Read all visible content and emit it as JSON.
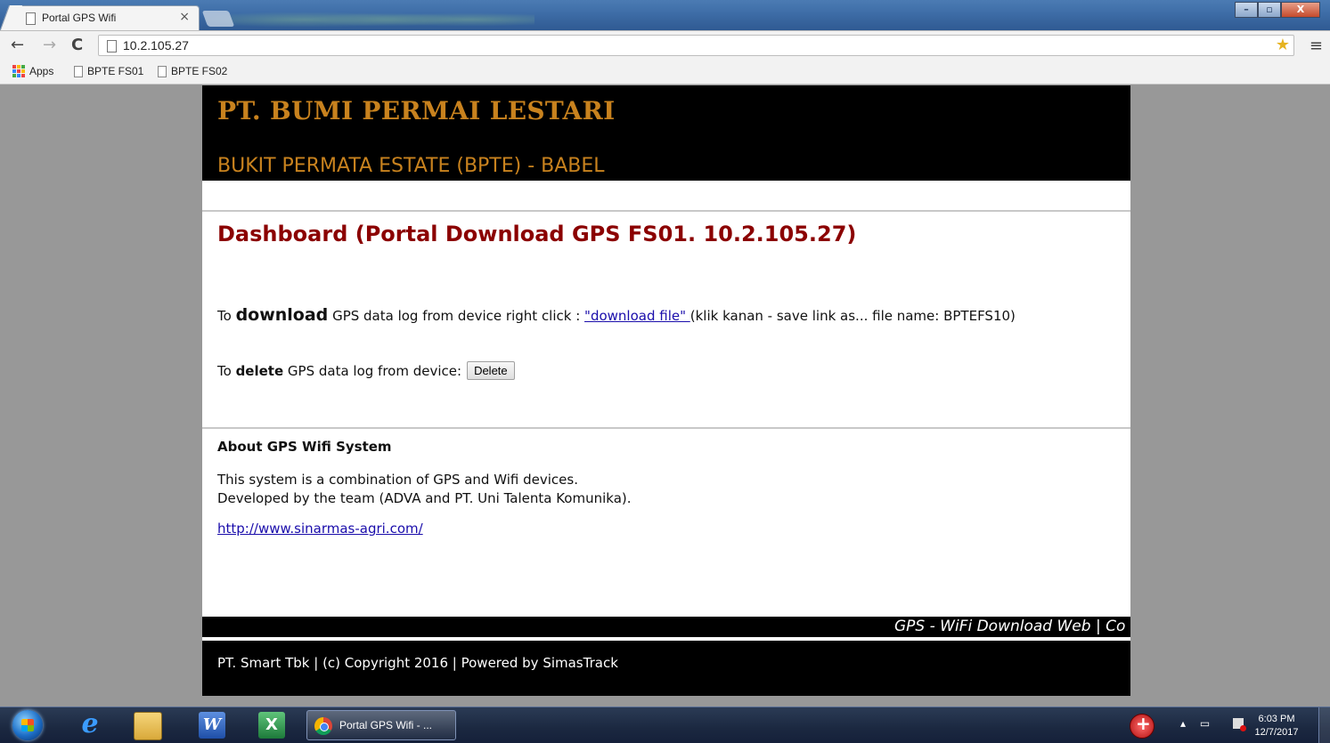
{
  "browser": {
    "tab_title": "Portal GPS Wifi",
    "tab_close": "×",
    "url": "10.2.105.27",
    "window_buttons": {
      "minimize": "–",
      "maximize": "▫",
      "close": "X"
    }
  },
  "bookmarks": {
    "apps": "Apps",
    "items": [
      "BPTE FS01",
      "BPTE FS02"
    ]
  },
  "header": {
    "company": "PT. BUMI PERMAI LESTARI",
    "estate": "BUKIT PERMATA ESTATE (BPTE) - BABEL"
  },
  "dashboard": {
    "title": "Dashboard (Portal Download GPS FS01. 10.2.105.27)",
    "download": {
      "prefix": "To ",
      "keyword": "download",
      "middle": " GPS data log from device right click : ",
      "link_text": "\"download file\" ",
      "suffix": "(klik kanan - save link as... file name: BPTEFS10)"
    },
    "delete": {
      "prefix": "To ",
      "keyword": "delete",
      "middle": " GPS data log from device:",
      "button": "Delete"
    }
  },
  "about": {
    "title": "About GPS Wifi System",
    "line1": "This system is a combination of GPS and Wifi devices.",
    "line2": "Developed by the team (ADVA and PT. Uni Talenta Komunika).",
    "link": "http://www.sinarmas-agri.com/"
  },
  "marquee": "GPS - WiFi Download Web | Co",
  "footer": "PT. Smart Tbk | (c) Copyright 2016 | Powered by SimasTrack",
  "taskbar": {
    "chrome_label": "Portal GPS Wifi - ...",
    "time": "6:03 PM",
    "date": "12/7/2017"
  },
  "colors": {
    "header_text": "#c8821e",
    "dashboard_title": "#8b0000",
    "link": "#1a0dab"
  }
}
